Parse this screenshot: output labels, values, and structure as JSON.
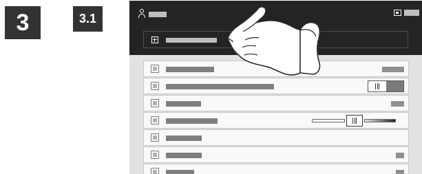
{
  "steps": {
    "main": "3",
    "sub": "3.1"
  },
  "topbar": {
    "user_icon": "user-icon",
    "device_icon": "device-icon"
  },
  "add_bar": {
    "icon": "plus-icon"
  },
  "rows": [
    {
      "icon": "document-icon",
      "control": "value"
    },
    {
      "icon": "diamond-icon",
      "control": "toggle",
      "toggle_state": "on"
    },
    {
      "icon": "lines-icon",
      "control": "value"
    },
    {
      "icon": "contrast-icon",
      "control": "slider",
      "slider_level": 0.5
    },
    {
      "icon": "grid-icon",
      "control": "none"
    },
    {
      "icon": "copies-icon",
      "control": "value"
    },
    {
      "icon": "portrait-icon",
      "control": "value"
    }
  ],
  "colors": {
    "screen_background": "#e2e2e2",
    "topbar_background": "#242424",
    "step_badge": "#333333"
  }
}
